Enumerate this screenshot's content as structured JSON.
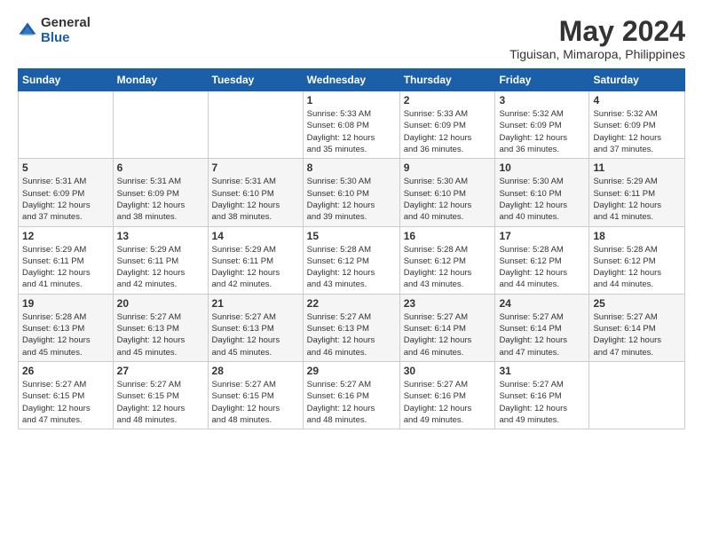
{
  "logo": {
    "general": "General",
    "blue": "Blue"
  },
  "title": "May 2024",
  "subtitle": "Tiguisan, Mimaropa, Philippines",
  "headers": [
    "Sunday",
    "Monday",
    "Tuesday",
    "Wednesday",
    "Thursday",
    "Friday",
    "Saturday"
  ],
  "weeks": [
    [
      {
        "day": "",
        "info": ""
      },
      {
        "day": "",
        "info": ""
      },
      {
        "day": "",
        "info": ""
      },
      {
        "day": "1",
        "info": "Sunrise: 5:33 AM\nSunset: 6:08 PM\nDaylight: 12 hours\nand 35 minutes."
      },
      {
        "day": "2",
        "info": "Sunrise: 5:33 AM\nSunset: 6:09 PM\nDaylight: 12 hours\nand 36 minutes."
      },
      {
        "day": "3",
        "info": "Sunrise: 5:32 AM\nSunset: 6:09 PM\nDaylight: 12 hours\nand 36 minutes."
      },
      {
        "day": "4",
        "info": "Sunrise: 5:32 AM\nSunset: 6:09 PM\nDaylight: 12 hours\nand 37 minutes."
      }
    ],
    [
      {
        "day": "5",
        "info": "Sunrise: 5:31 AM\nSunset: 6:09 PM\nDaylight: 12 hours\nand 37 minutes."
      },
      {
        "day": "6",
        "info": "Sunrise: 5:31 AM\nSunset: 6:09 PM\nDaylight: 12 hours\nand 38 minutes."
      },
      {
        "day": "7",
        "info": "Sunrise: 5:31 AM\nSunset: 6:10 PM\nDaylight: 12 hours\nand 38 minutes."
      },
      {
        "day": "8",
        "info": "Sunrise: 5:30 AM\nSunset: 6:10 PM\nDaylight: 12 hours\nand 39 minutes."
      },
      {
        "day": "9",
        "info": "Sunrise: 5:30 AM\nSunset: 6:10 PM\nDaylight: 12 hours\nand 40 minutes."
      },
      {
        "day": "10",
        "info": "Sunrise: 5:30 AM\nSunset: 6:10 PM\nDaylight: 12 hours\nand 40 minutes."
      },
      {
        "day": "11",
        "info": "Sunrise: 5:29 AM\nSunset: 6:11 PM\nDaylight: 12 hours\nand 41 minutes."
      }
    ],
    [
      {
        "day": "12",
        "info": "Sunrise: 5:29 AM\nSunset: 6:11 PM\nDaylight: 12 hours\nand 41 minutes."
      },
      {
        "day": "13",
        "info": "Sunrise: 5:29 AM\nSunset: 6:11 PM\nDaylight: 12 hours\nand 42 minutes."
      },
      {
        "day": "14",
        "info": "Sunrise: 5:29 AM\nSunset: 6:11 PM\nDaylight: 12 hours\nand 42 minutes."
      },
      {
        "day": "15",
        "info": "Sunrise: 5:28 AM\nSunset: 6:12 PM\nDaylight: 12 hours\nand 43 minutes."
      },
      {
        "day": "16",
        "info": "Sunrise: 5:28 AM\nSunset: 6:12 PM\nDaylight: 12 hours\nand 43 minutes."
      },
      {
        "day": "17",
        "info": "Sunrise: 5:28 AM\nSunset: 6:12 PM\nDaylight: 12 hours\nand 44 minutes."
      },
      {
        "day": "18",
        "info": "Sunrise: 5:28 AM\nSunset: 6:12 PM\nDaylight: 12 hours\nand 44 minutes."
      }
    ],
    [
      {
        "day": "19",
        "info": "Sunrise: 5:28 AM\nSunset: 6:13 PM\nDaylight: 12 hours\nand 45 minutes."
      },
      {
        "day": "20",
        "info": "Sunrise: 5:27 AM\nSunset: 6:13 PM\nDaylight: 12 hours\nand 45 minutes."
      },
      {
        "day": "21",
        "info": "Sunrise: 5:27 AM\nSunset: 6:13 PM\nDaylight: 12 hours\nand 45 minutes."
      },
      {
        "day": "22",
        "info": "Sunrise: 5:27 AM\nSunset: 6:13 PM\nDaylight: 12 hours\nand 46 minutes."
      },
      {
        "day": "23",
        "info": "Sunrise: 5:27 AM\nSunset: 6:14 PM\nDaylight: 12 hours\nand 46 minutes."
      },
      {
        "day": "24",
        "info": "Sunrise: 5:27 AM\nSunset: 6:14 PM\nDaylight: 12 hours\nand 47 minutes."
      },
      {
        "day": "25",
        "info": "Sunrise: 5:27 AM\nSunset: 6:14 PM\nDaylight: 12 hours\nand 47 minutes."
      }
    ],
    [
      {
        "day": "26",
        "info": "Sunrise: 5:27 AM\nSunset: 6:15 PM\nDaylight: 12 hours\nand 47 minutes."
      },
      {
        "day": "27",
        "info": "Sunrise: 5:27 AM\nSunset: 6:15 PM\nDaylight: 12 hours\nand 48 minutes."
      },
      {
        "day": "28",
        "info": "Sunrise: 5:27 AM\nSunset: 6:15 PM\nDaylight: 12 hours\nand 48 minutes."
      },
      {
        "day": "29",
        "info": "Sunrise: 5:27 AM\nSunset: 6:16 PM\nDaylight: 12 hours\nand 48 minutes."
      },
      {
        "day": "30",
        "info": "Sunrise: 5:27 AM\nSunset: 6:16 PM\nDaylight: 12 hours\nand 49 minutes."
      },
      {
        "day": "31",
        "info": "Sunrise: 5:27 AM\nSunset: 6:16 PM\nDaylight: 12 hours\nand 49 minutes."
      },
      {
        "day": "",
        "info": ""
      }
    ]
  ]
}
